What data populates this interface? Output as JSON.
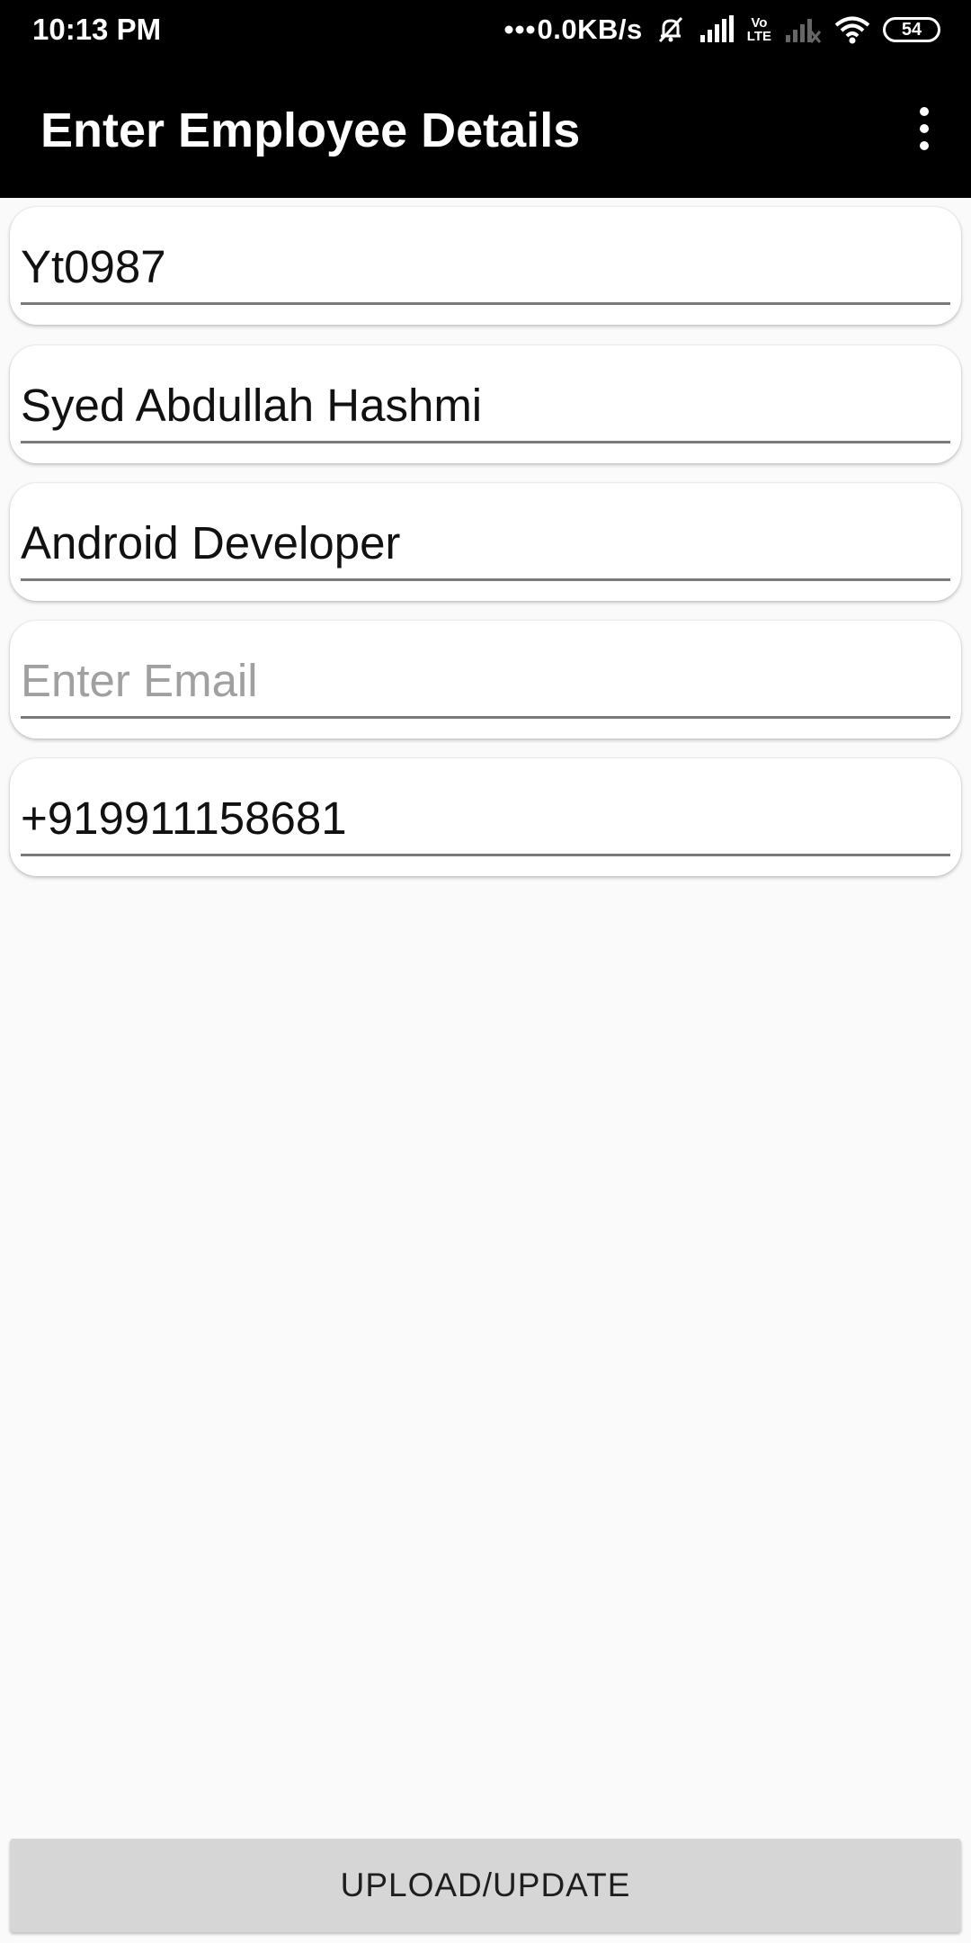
{
  "status_bar": {
    "time": "10:13 PM",
    "net_speed": "0.0KB/s",
    "volte_top": "Vo",
    "volte_bottom": "LTE",
    "battery": "54",
    "icons": [
      "dots-icon",
      "mute-bell-icon",
      "signal-icon",
      "volte-icon",
      "signal-no-sim-icon",
      "wifi-icon",
      "battery-icon"
    ]
  },
  "app_bar": {
    "title": "Enter Employee Details",
    "menu_icon": "overflow-menu-icon"
  },
  "form": {
    "employee_id": {
      "value": "Yt0987",
      "placeholder": ""
    },
    "name": {
      "value": "Syed Abdullah Hashmi",
      "placeholder": ""
    },
    "designation": {
      "value": "Android Developer",
      "placeholder": ""
    },
    "email": {
      "value": "",
      "placeholder": "Enter Email"
    },
    "phone": {
      "value": "+919911158681",
      "placeholder": ""
    }
  },
  "actions": {
    "upload_label": "UPLOAD/UPDATE"
  }
}
